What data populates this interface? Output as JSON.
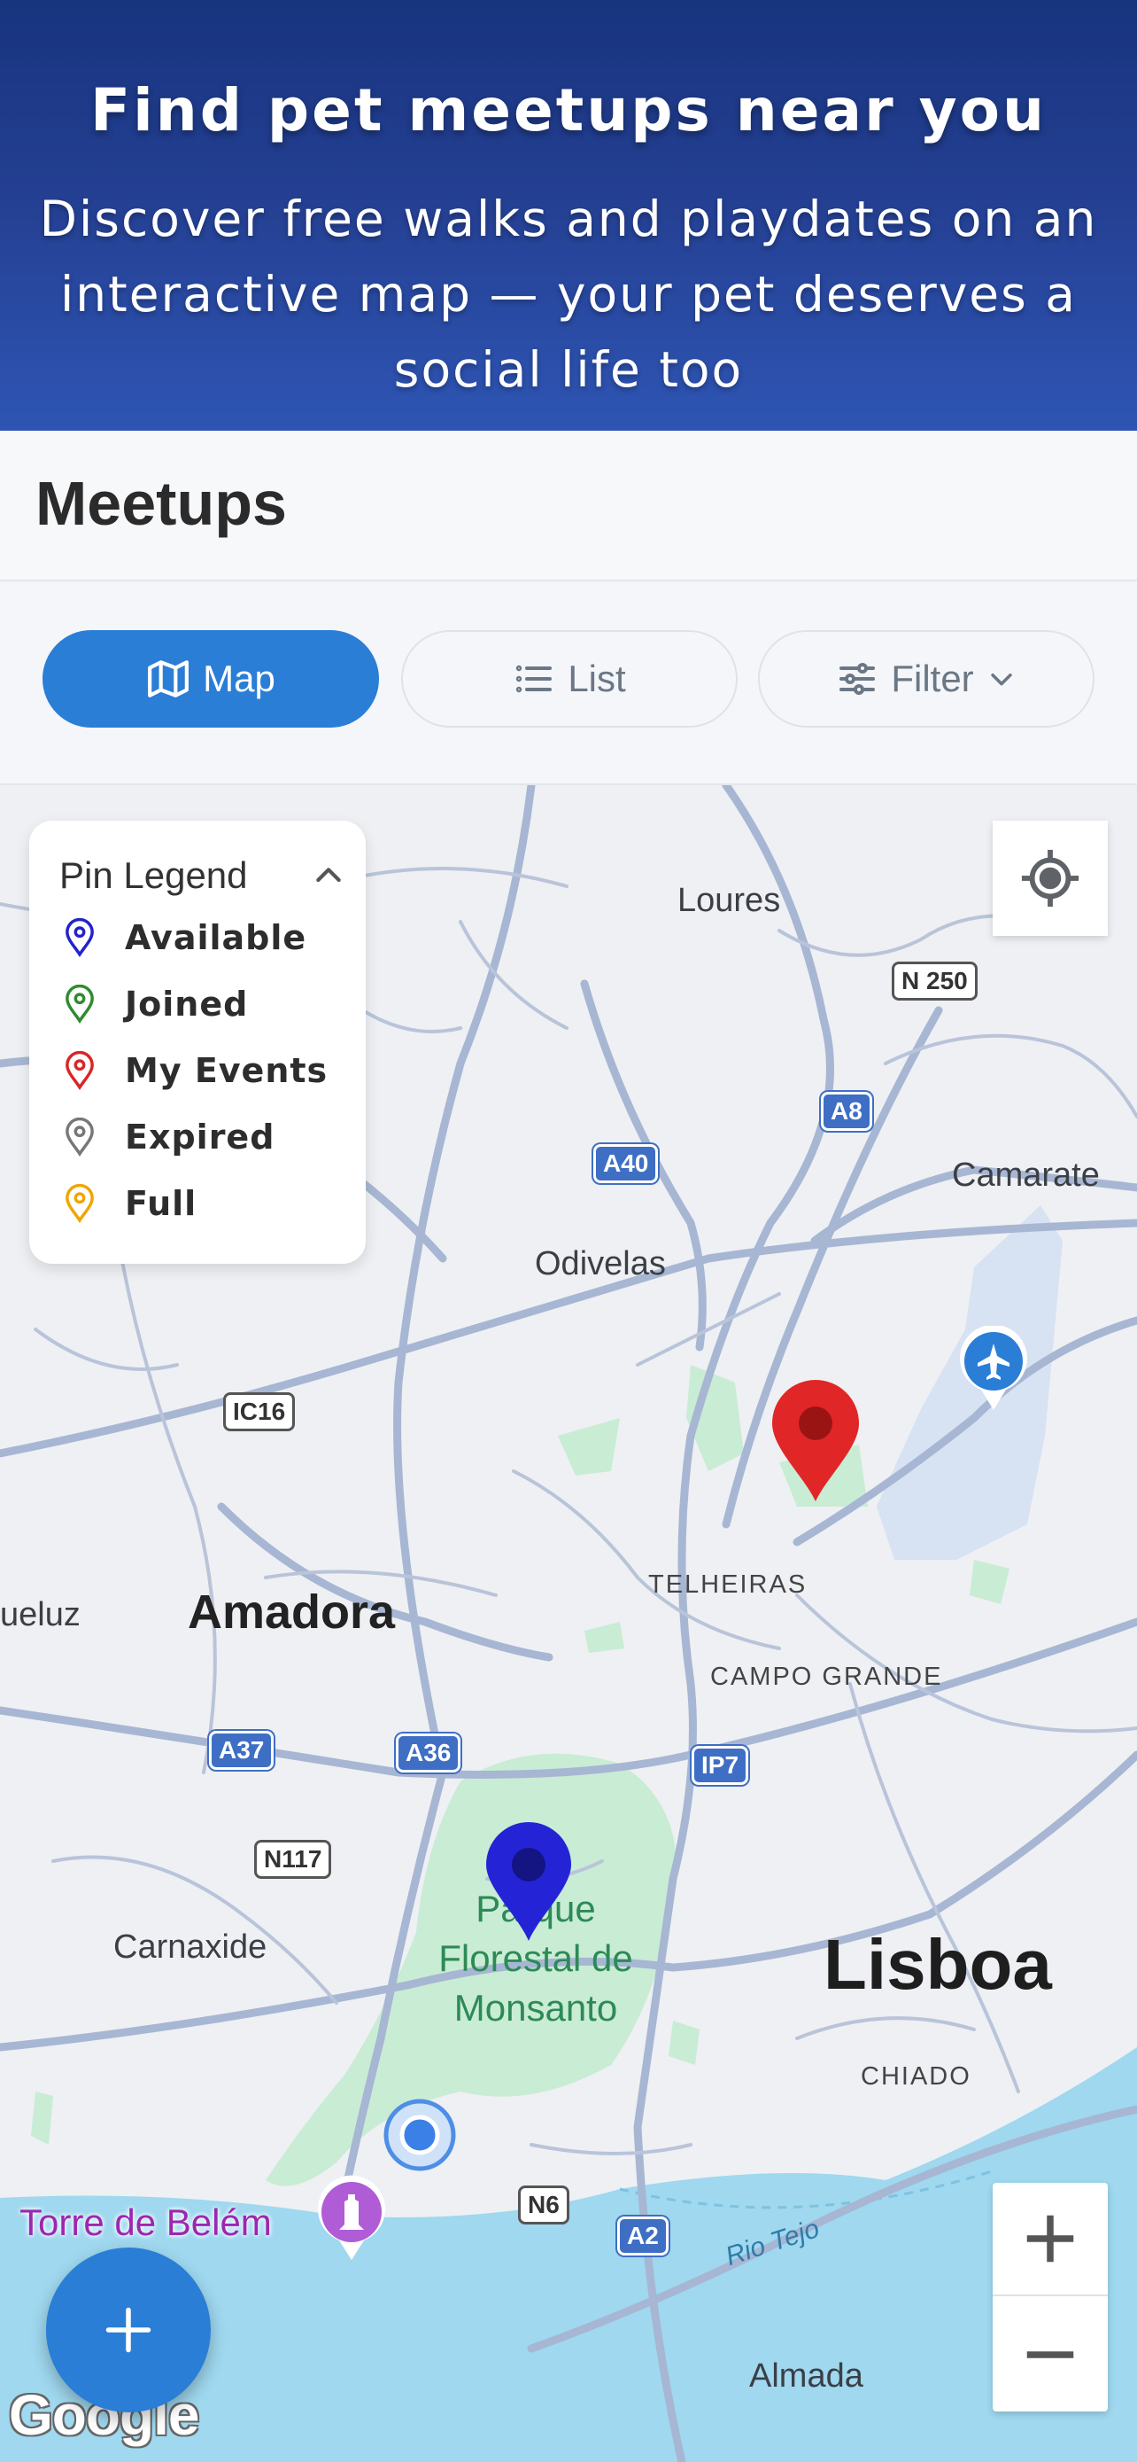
{
  "hero": {
    "title": "Find pet meetups near you",
    "subtitle": "Discover free walks and playdates on an interactive map — your pet deserves a social life too"
  },
  "page": {
    "title": "Meetups"
  },
  "view_toggle": {
    "map_label": "Map",
    "list_label": "List",
    "filter_label": "Filter",
    "active": "Map"
  },
  "legend": {
    "title": "Pin Legend",
    "items": [
      {
        "label": "Available",
        "color": "#2222cc"
      },
      {
        "label": "Joined",
        "color": "#2e8b2e"
      },
      {
        "label": "My Events",
        "color": "#d92626"
      },
      {
        "label": "Expired",
        "color": "#777777"
      },
      {
        "label": "Full",
        "color": "#f0a500"
      }
    ]
  },
  "map": {
    "places": {
      "loures": "Loures",
      "camarate": "Camarate",
      "odivelas": "Odivelas",
      "amadora": "Amadora",
      "queluz": "ueluz",
      "telheiras": "TELHEIRAS",
      "campo_grande": "CAMPO GRANDE",
      "carnaxide": "Carnaxide",
      "lisboa": "Lisboa",
      "chiado": "CHIADO",
      "park": "Parque Florestal de Monsanto",
      "rio_tejo": "Rio Tejo",
      "almada": "Almada",
      "torre_de_belem": "Torre de Belém"
    },
    "roads": {
      "n250": "N 250",
      "a8": "A8",
      "a40": "A40",
      "ic16": "IC16",
      "a37": "A37",
      "a36": "A36",
      "ip7": "IP7",
      "n117": "N117",
      "n6": "N6",
      "a2": "A2"
    },
    "attribution": "Google",
    "pins": [
      {
        "status": "My Events",
        "color": "#d92626"
      },
      {
        "status": "Available",
        "color": "#2222cc"
      }
    ],
    "colors": {
      "water": "#9fd8ef",
      "park": "#c9ecd4",
      "road": "#a7b6d3",
      "land": "#eef0f3"
    }
  }
}
